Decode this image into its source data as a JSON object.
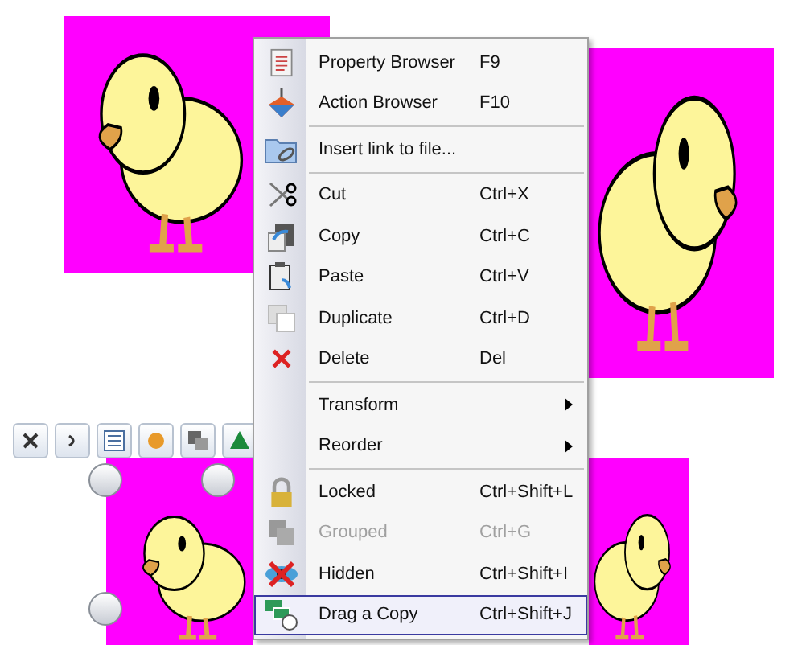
{
  "context_menu": {
    "sections": [
      [
        {
          "label": "Property Browser",
          "shortcut": "F9",
          "kind": "command",
          "disabled": false,
          "selected": false
        },
        {
          "label": "Action Browser",
          "shortcut": "F10",
          "kind": "command",
          "disabled": false,
          "selected": false
        }
      ],
      [
        {
          "label": "Insert link to file...",
          "kind": "command",
          "disabled": false,
          "selected": false
        }
      ],
      [
        {
          "label": "Cut",
          "shortcut": "Ctrl+X",
          "kind": "command",
          "disabled": false,
          "selected": false
        },
        {
          "label": "Copy",
          "shortcut": "Ctrl+C",
          "kind": "command",
          "disabled": false,
          "selected": false
        },
        {
          "label": "Paste",
          "shortcut": "Ctrl+V",
          "kind": "command",
          "disabled": false,
          "selected": false
        },
        {
          "label": "Duplicate",
          "shortcut": "Ctrl+D",
          "kind": "command",
          "disabled": false,
          "selected": false
        },
        {
          "label": "Delete",
          "shortcut": "Del",
          "kind": "command",
          "disabled": false,
          "selected": false
        }
      ],
      [
        {
          "label": "Transform",
          "kind": "submenu",
          "disabled": false,
          "selected": false
        },
        {
          "label": "Reorder",
          "kind": "submenu",
          "disabled": false,
          "selected": false
        }
      ],
      [
        {
          "label": "Locked",
          "shortcut": "Ctrl+Shift+L",
          "kind": "command",
          "disabled": false,
          "selected": false
        },
        {
          "label": "Grouped",
          "shortcut": "Ctrl+G",
          "kind": "command",
          "disabled": true,
          "selected": false
        },
        {
          "label": "Hidden",
          "shortcut": "Ctrl+Shift+I",
          "kind": "command",
          "disabled": false,
          "selected": false
        },
        {
          "label": "Drag a Copy",
          "shortcut": "Ctrl+Shift+J",
          "kind": "command",
          "disabled": false,
          "selected": true
        }
      ]
    ]
  }
}
